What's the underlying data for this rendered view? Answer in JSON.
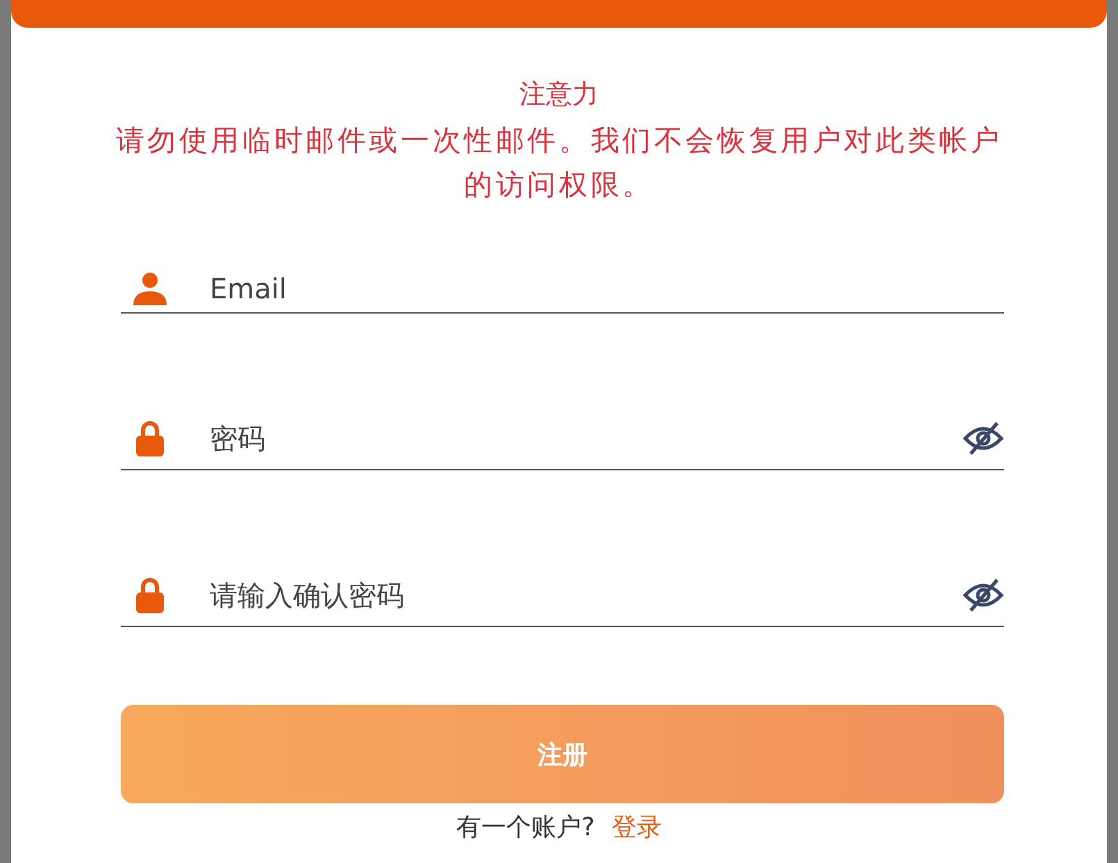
{
  "notice": {
    "title": "注意力",
    "message": "请勿使用临时邮件或一次性邮件。我们不会恢复用户对此类帐户的访问权限。"
  },
  "fields": [
    {
      "kind": "email",
      "placeholder": "Email"
    },
    {
      "kind": "password",
      "placeholder": "密码"
    },
    {
      "kind": "password",
      "placeholder": "请输入确认密码"
    }
  ],
  "submit_button": "注册",
  "footer": {
    "text": "有一个账户?",
    "link": "登录"
  }
}
